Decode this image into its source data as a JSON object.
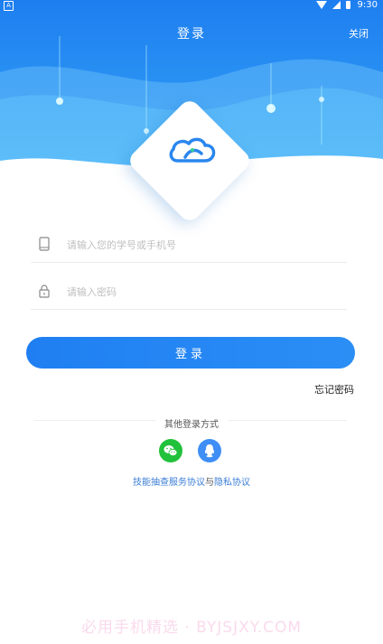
{
  "status_bar": {
    "time": "9:30",
    "left_icon": "A"
  },
  "header": {
    "title": "登录",
    "close_label": "关闭"
  },
  "form": {
    "account_placeholder": "请输入您的学号或手机号",
    "password_placeholder": "请输入密码",
    "account_value": "",
    "password_value": ""
  },
  "login_button": "登录",
  "forgot_password": "忘记密码",
  "other_login": {
    "label": "其他登录方式",
    "options": [
      {
        "name": "wechat",
        "icon": "wechat-icon",
        "color": "#22c13b"
      },
      {
        "name": "qq",
        "icon": "qq-icon",
        "color": "#3f8ef5"
      }
    ]
  },
  "agreement": {
    "service": "技能抽查服务协议",
    "connector": "与",
    "privacy": "隐私协议"
  },
  "watermark": "必用手机精选 · BYJSJXY.COM",
  "colors": {
    "primary": "#1f7ff2",
    "link": "#3b7ed6"
  }
}
